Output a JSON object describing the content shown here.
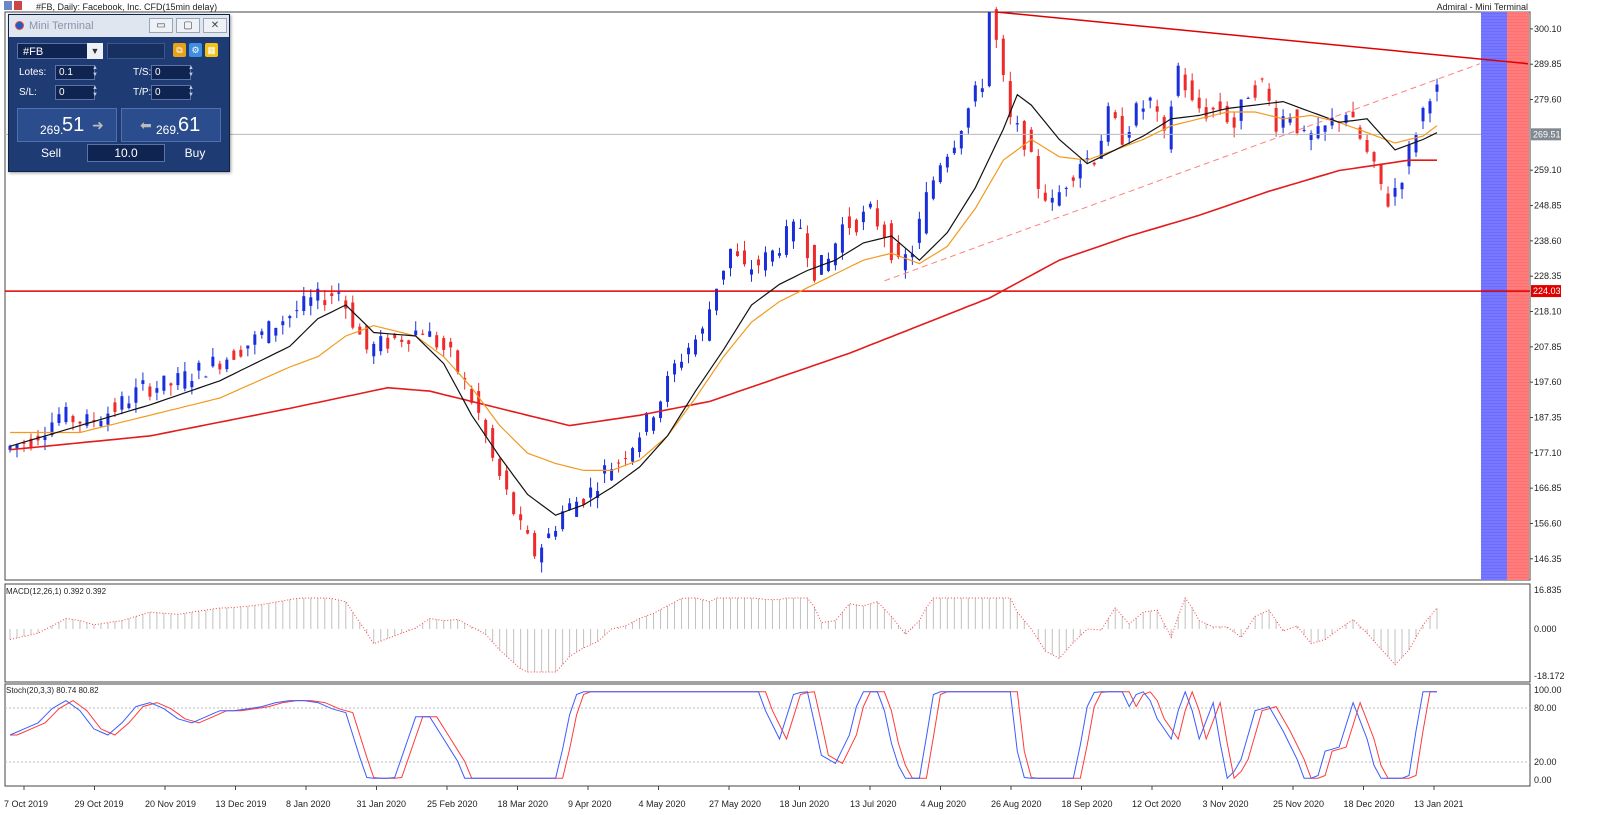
{
  "window": {
    "title": "#FB, Daily:  Facebook, Inc. CFD(15min delay)",
    "right_label": "Admiral - Mini Terminal"
  },
  "mini_terminal": {
    "title": "Mini Terminal",
    "symbol": "#FB",
    "lots_label": "Lotes:",
    "lots_value": "0.1",
    "ts_label": "T/S:",
    "ts_value": "0",
    "sl_label": "S/L:",
    "sl_value": "0",
    "tp_label": "T/P:",
    "tp_value": "0",
    "sell_small": "269.",
    "sell_big": "51",
    "buy_small": "269.",
    "buy_big": "61",
    "sell_label": "Sell",
    "buy_label": "Buy",
    "lot_size": "10.0"
  },
  "chart_data": {
    "type": "candlestick",
    "symbol": "#FB",
    "timeframe": "Daily",
    "price_ticks": [
      "300.10",
      "289.85",
      "279.60",
      "269.51",
      "259.10",
      "248.85",
      "238.60",
      "228.35",
      "218.10",
      "207.85",
      "197.60",
      "187.35",
      "177.10",
      "166.85",
      "156.60",
      "146.35"
    ],
    "date_labels": [
      "7 Oct 2019",
      "29 Oct 2019",
      "20 Nov 2019",
      "13 Dec 2019",
      "8 Jan 2020",
      "31 Jan 2020",
      "25 Feb 2020",
      "18 Mar 2020",
      "9 Apr 2020",
      "4 May 2020",
      "27 May 2020",
      "18 Jun 2020",
      "13 Jul 2020",
      "4 Aug 2020",
      "26 Aug 2020",
      "18 Sep 2020",
      "12 Oct 2020",
      "3 Nov 2020",
      "25 Nov 2020",
      "18 Dec 2020",
      "13 Jan 2021"
    ],
    "current_price": "269.51",
    "horizontal_level": "224.03",
    "price_path": [
      [
        0,
        178
      ],
      [
        4,
        181
      ],
      [
        8,
        188
      ],
      [
        12,
        186
      ],
      [
        16,
        190
      ],
      [
        20,
        196
      ],
      [
        24,
        197
      ],
      [
        28,
        201
      ],
      [
        32,
        205
      ],
      [
        36,
        210
      ],
      [
        40,
        216
      ],
      [
        44,
        221
      ],
      [
        48,
        224
      ],
      [
        52,
        207
      ],
      [
        56,
        210
      ],
      [
        60,
        213
      ],
      [
        64,
        205
      ],
      [
        66,
        197
      ],
      [
        68,
        188
      ],
      [
        70,
        175
      ],
      [
        72,
        165
      ],
      [
        74,
        155
      ],
      [
        76,
        148
      ],
      [
        78,
        153
      ],
      [
        80,
        160
      ],
      [
        82,
        163
      ],
      [
        84,
        166
      ],
      [
        86,
        172
      ],
      [
        88,
        175
      ],
      [
        90,
        180
      ],
      [
        92,
        186
      ],
      [
        94,
        193
      ],
      [
        96,
        202
      ],
      [
        98,
        208
      ],
      [
        100,
        212
      ],
      [
        102,
        226
      ],
      [
        104,
        236
      ],
      [
        106,
        230
      ],
      [
        108,
        232
      ],
      [
        110,
        235
      ],
      [
        112,
        240
      ],
      [
        114,
        243
      ],
      [
        116,
        230
      ],
      [
        118,
        233
      ],
      [
        120,
        243
      ],
      [
        122,
        244
      ],
      [
        124,
        247
      ],
      [
        126,
        241
      ],
      [
        128,
        231
      ],
      [
        130,
        236
      ],
      [
        132,
        251
      ],
      [
        134,
        262
      ],
      [
        136,
        268
      ],
      [
        138,
        277
      ],
      [
        140,
        285
      ],
      [
        141,
        305
      ],
      [
        142,
        296
      ],
      [
        144,
        273
      ],
      [
        146,
        268
      ],
      [
        148,
        255
      ],
      [
        150,
        249
      ],
      [
        152,
        256
      ],
      [
        154,
        262
      ],
      [
        156,
        263
      ],
      [
        158,
        275
      ],
      [
        160,
        269
      ],
      [
        162,
        276
      ],
      [
        164,
        279
      ],
      [
        166,
        268
      ],
      [
        168,
        289
      ],
      [
        170,
        278
      ],
      [
        172,
        276
      ],
      [
        174,
        277
      ],
      [
        176,
        272
      ],
      [
        178,
        282
      ],
      [
        180,
        284
      ],
      [
        182,
        273
      ],
      [
        184,
        276
      ],
      [
        186,
        268
      ],
      [
        188,
        269
      ],
      [
        190,
        273
      ],
      [
        192,
        276
      ],
      [
        194,
        268
      ],
      [
        196,
        259
      ],
      [
        198,
        250
      ],
      [
        200,
        258
      ],
      [
        202,
        271
      ],
      [
        204,
        282
      ]
    ],
    "ma20_path": [
      [
        0,
        179
      ],
      [
        10,
        185
      ],
      [
        20,
        191
      ],
      [
        30,
        198
      ],
      [
        40,
        208
      ],
      [
        44,
        216
      ],
      [
        48,
        220
      ],
      [
        52,
        212
      ],
      [
        58,
        211
      ],
      [
        62,
        203
      ],
      [
        66,
        188
      ],
      [
        70,
        176
      ],
      [
        74,
        165
      ],
      [
        78,
        159
      ],
      [
        82,
        162
      ],
      [
        86,
        167
      ],
      [
        90,
        173
      ],
      [
        94,
        182
      ],
      [
        98,
        195
      ],
      [
        102,
        207
      ],
      [
        106,
        220
      ],
      [
        110,
        226
      ],
      [
        114,
        230
      ],
      [
        118,
        233
      ],
      [
        122,
        238
      ],
      [
        126,
        240
      ],
      [
        130,
        233
      ],
      [
        134,
        241
      ],
      [
        138,
        254
      ],
      [
        142,
        271
      ],
      [
        144,
        281
      ],
      [
        146,
        278
      ],
      [
        150,
        268
      ],
      [
        154,
        261
      ],
      [
        158,
        265
      ],
      [
        162,
        269
      ],
      [
        166,
        274
      ],
      [
        170,
        275
      ],
      [
        174,
        277
      ],
      [
        178,
        278
      ],
      [
        182,
        279
      ],
      [
        186,
        276
      ],
      [
        190,
        273
      ],
      [
        194,
        274
      ],
      [
        198,
        265
      ],
      [
        202,
        268
      ],
      [
        204,
        270
      ]
    ],
    "ma50_path": [
      [
        0,
        183
      ],
      [
        10,
        183
      ],
      [
        20,
        188
      ],
      [
        30,
        193
      ],
      [
        40,
        202
      ],
      [
        44,
        205
      ],
      [
        48,
        211
      ],
      [
        52,
        214
      ],
      [
        58,
        211
      ],
      [
        62,
        205
      ],
      [
        66,
        196
      ],
      [
        70,
        185
      ],
      [
        74,
        177
      ],
      [
        78,
        174
      ],
      [
        82,
        172
      ],
      [
        86,
        172
      ],
      [
        90,
        175
      ],
      [
        94,
        182
      ],
      [
        98,
        193
      ],
      [
        102,
        205
      ],
      [
        106,
        215
      ],
      [
        110,
        221
      ],
      [
        114,
        225
      ],
      [
        118,
        229
      ],
      [
        122,
        233
      ],
      [
        126,
        235
      ],
      [
        130,
        232
      ],
      [
        134,
        237
      ],
      [
        138,
        248
      ],
      [
        142,
        262
      ],
      [
        146,
        268
      ],
      [
        150,
        263
      ],
      [
        154,
        262
      ],
      [
        158,
        265
      ],
      [
        162,
        268
      ],
      [
        166,
        272
      ],
      [
        170,
        274
      ],
      [
        174,
        276
      ],
      [
        178,
        276
      ],
      [
        182,
        274
      ],
      [
        186,
        275
      ],
      [
        190,
        273
      ],
      [
        194,
        270
      ],
      [
        198,
        267
      ],
      [
        202,
        269
      ],
      [
        204,
        272
      ]
    ],
    "ma200_path": [
      [
        0,
        178
      ],
      [
        20,
        182
      ],
      [
        40,
        190
      ],
      [
        54,
        196
      ],
      [
        60,
        195
      ],
      [
        70,
        190
      ],
      [
        80,
        185
      ],
      [
        90,
        188
      ],
      [
        100,
        192
      ],
      [
        110,
        199
      ],
      [
        120,
        206
      ],
      [
        130,
        214
      ],
      [
        140,
        222
      ],
      [
        150,
        233
      ],
      [
        160,
        240
      ],
      [
        170,
        246
      ],
      [
        180,
        253
      ],
      [
        190,
        259
      ],
      [
        200,
        262
      ],
      [
        204,
        262
      ]
    ],
    "resistance_trendline": {
      "from": [
        141,
        305
      ],
      "to": [
        214,
        290
      ]
    },
    "support_trendline": {
      "from": [
        125,
        227
      ],
      "to": [
        210,
        290
      ]
    },
    "macd": {
      "label": "MACD(12,26,1) 0.392 0.392",
      "ticks": [
        "16.835",
        "0.000",
        "-18.172"
      ]
    },
    "stoch": {
      "label": "Stoch(20,3,3) 80.74 80.82",
      "ticks": [
        "100.00",
        "80.00",
        "20.00",
        "0.00"
      ]
    },
    "colors": {
      "bull": "#1a2fdc",
      "bear": "#ee2a2a",
      "ma20": "#111111",
      "ma50": "#f29a1f",
      "ma200": "#e41b1b",
      "stoch_main": "#3b5cff",
      "stoch_signal": "#ff3b3b"
    }
  }
}
